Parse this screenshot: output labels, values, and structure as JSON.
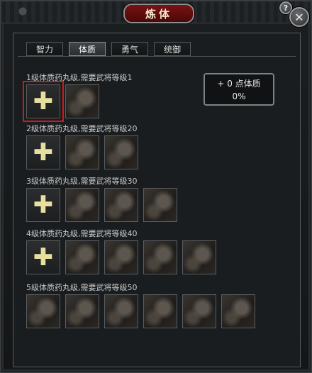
{
  "window": {
    "title": "炼体",
    "help_label": "?",
    "close_label": "✕"
  },
  "tabs": [
    {
      "label": "智力",
      "active": false
    },
    {
      "label": "体质",
      "active": true
    },
    {
      "label": "勇气",
      "active": false
    },
    {
      "label": "统御",
      "active": false
    }
  ],
  "points": {
    "line1": "+ 0 点体质",
    "line2": "0%"
  },
  "tiers": [
    {
      "label": "1级体质药丸级,需要武将等级1",
      "slots": [
        "add-selected",
        "empty"
      ]
    },
    {
      "label": "2级体质药丸级,需要武将等级20",
      "slots": [
        "add",
        "empty",
        "empty"
      ]
    },
    {
      "label": "3级体质药丸级,需要武将等级30",
      "slots": [
        "add",
        "empty",
        "empty",
        "empty"
      ]
    },
    {
      "label": "4级体质药丸级,需要武将等级40",
      "slots": [
        "add",
        "empty",
        "empty",
        "empty",
        "empty"
      ]
    },
    {
      "label": "5级体质药丸级,需要武将等级50",
      "slots": [
        "empty",
        "empty",
        "empty",
        "empty",
        "empty",
        "empty"
      ]
    }
  ],
  "icons": {
    "add": "plus-icon",
    "empty": "locked-slot-icon"
  }
}
